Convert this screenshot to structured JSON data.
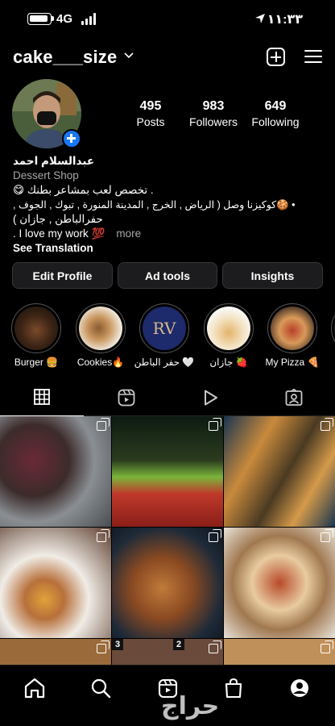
{
  "status_bar": {
    "network": "4G",
    "time": "١١:٣٣"
  },
  "header": {
    "username": "cake___size"
  },
  "stats": [
    {
      "value": "495",
      "label": "Posts"
    },
    {
      "value": "983",
      "label": "Followers"
    },
    {
      "value": "649",
      "label": "Following"
    }
  ],
  "bio": {
    "name": "عبدالسلام احمد",
    "category": "Dessert Shop",
    "line1": ". تخصص لعب بمشاعر بطنك 😋",
    "line2": "• 🍪كوكيزنا وصل ( الرياض , الخرج , المدينة المنورة , تبوك , الجوف ,",
    "line3": "حفرالباطن , جازان )",
    "line4": ". I love my work 💯",
    "more": "more",
    "see_translation": "See Translation"
  },
  "buttons": {
    "edit_profile": "Edit Profile",
    "ad_tools": "Ad tools",
    "insights": "Insights"
  },
  "highlights": [
    {
      "label": "Burger 🍔"
    },
    {
      "label": "Cookies🔥"
    },
    {
      "label": "حفر الباطن 🤍"
    },
    {
      "label": "جازان 🍓"
    },
    {
      "label": "My Pizza 🍕"
    }
  ],
  "highlight_logo_text": "RV",
  "grid_badges": {
    "row3_col1": "3",
    "row3_col2": "2"
  },
  "watermark": "حراج",
  "colors": {
    "accent_blue": "#1877f2",
    "background": "#000000",
    "button_bg": "#1c1c1e"
  }
}
